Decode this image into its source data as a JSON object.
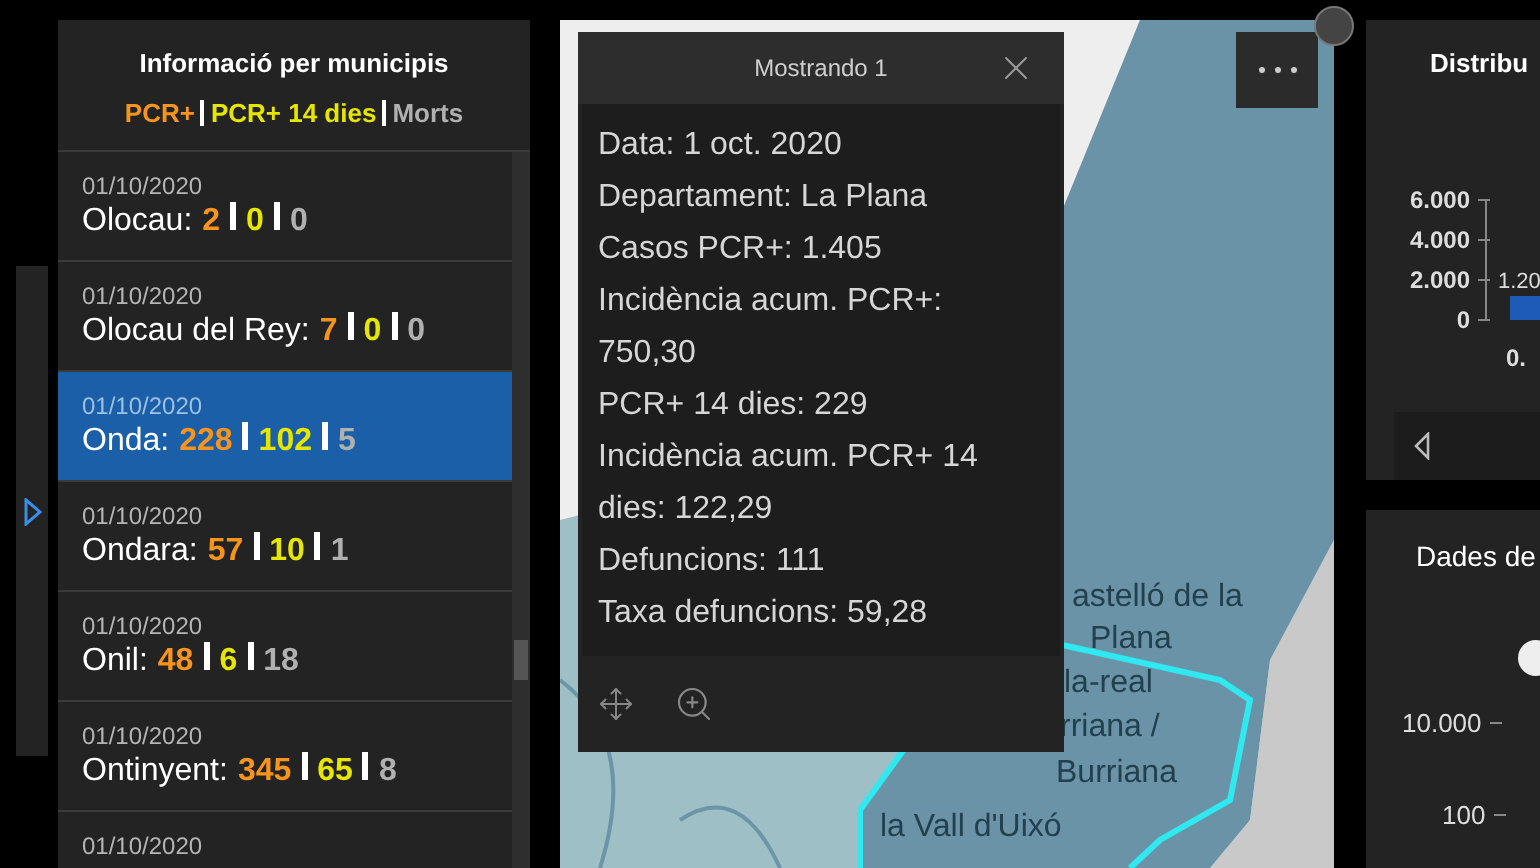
{
  "sidebar": {
    "title": "Informació per municipis",
    "legend": [
      "PCR+",
      "PCR+ 14 dies",
      "Morts"
    ],
    "rows": [
      {
        "date": "01/10/2020",
        "name": "Olocau:",
        "values": [
          "2",
          "0",
          "0"
        ],
        "selected": false
      },
      {
        "date": "01/10/2020",
        "name": "Olocau del Rey:",
        "values": [
          "7",
          "0",
          "0"
        ],
        "selected": false
      },
      {
        "date": "01/10/2020",
        "name": "Onda:",
        "values": [
          "228",
          "102",
          "5"
        ],
        "selected": true
      },
      {
        "date": "01/10/2020",
        "name": "Ondara:",
        "values": [
          "57",
          "10",
          "1"
        ],
        "selected": false
      },
      {
        "date": "01/10/2020",
        "name": "Onil:",
        "values": [
          "48",
          "6",
          "18"
        ],
        "selected": false
      },
      {
        "date": "01/10/2020",
        "name": "Ontinyent:",
        "values": [
          "345",
          "65",
          "8"
        ],
        "selected": false
      },
      {
        "date": "01/10/2020",
        "selected": false
      }
    ]
  },
  "map": {
    "labels": [
      "astelló de la",
      "Plana",
      "la-real",
      "rriana /",
      "Burriana",
      "la Vall d'Uixó"
    ],
    "popup": {
      "title": "Mostrando 1",
      "lines": [
        "Data: 1 oct. 2020",
        "Departament: La Plana",
        "Casos PCR+: 1.405",
        "Incidència acum. PCR+: 750,30",
        "PCR+ 14 dies: 229",
        "Incidència acum. PCR+ 14 dies: 122,29",
        "Defuncions: 111",
        "Taxa defuncions: 59,28"
      ]
    }
  },
  "chart_panel": {
    "title": "Distribu",
    "chart_data": {
      "type": "bar",
      "categories": [
        "0."
      ],
      "series": [
        {
          "color": "#1e5bb8",
          "values": [
            1200
          ]
        }
      ],
      "yticks": [
        {
          "value": 6000,
          "label": "6.000"
        },
        {
          "value": 4000,
          "label": "4.000"
        },
        {
          "value": 2000,
          "label": "2.000"
        },
        {
          "value": 0,
          "label": "0"
        }
      ],
      "ylim": [
        0,
        6000
      ],
      "value_labels": [
        "1.20"
      ]
    }
  },
  "data_panel": {
    "title": "Dades de",
    "ticks": [
      "10.000",
      "100"
    ]
  }
}
